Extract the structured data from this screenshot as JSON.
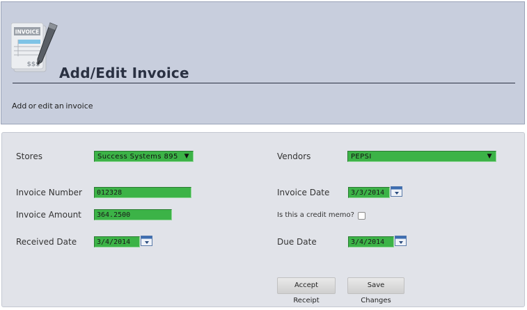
{
  "header": {
    "title": "Add/Edit Invoice",
    "subtitle": "Add or edit an invoice",
    "logo": {
      "icon": "invoice-document-with-pen-icon",
      "text": "INVOICE",
      "amount": "$$$"
    }
  },
  "form": {
    "stores": {
      "label": "Stores",
      "value": "Success Systems 895"
    },
    "vendors": {
      "label": "Vendors",
      "value": "PEPSI"
    },
    "invoice_number": {
      "label": "Invoice Number",
      "value": "012328"
    },
    "invoice_date": {
      "label": "Invoice Date",
      "value": "3/3/2014"
    },
    "invoice_amount": {
      "label": "Invoice Amount",
      "value": "364.2500"
    },
    "credit_memo": {
      "label": "Is this a credit memo?",
      "checked": false
    },
    "received_date": {
      "label": "Received Date",
      "value": "3/4/2014"
    },
    "due_date": {
      "label": "Due Date",
      "value": "3/4/2014"
    }
  },
  "buttons": {
    "accept_receipt": "Accept Receipt",
    "save_changes": "Save Changes"
  },
  "colors": {
    "header_bg": "#c8cedd",
    "panel_bg": "#e1e3e9",
    "field_bg": "#3cb347"
  }
}
